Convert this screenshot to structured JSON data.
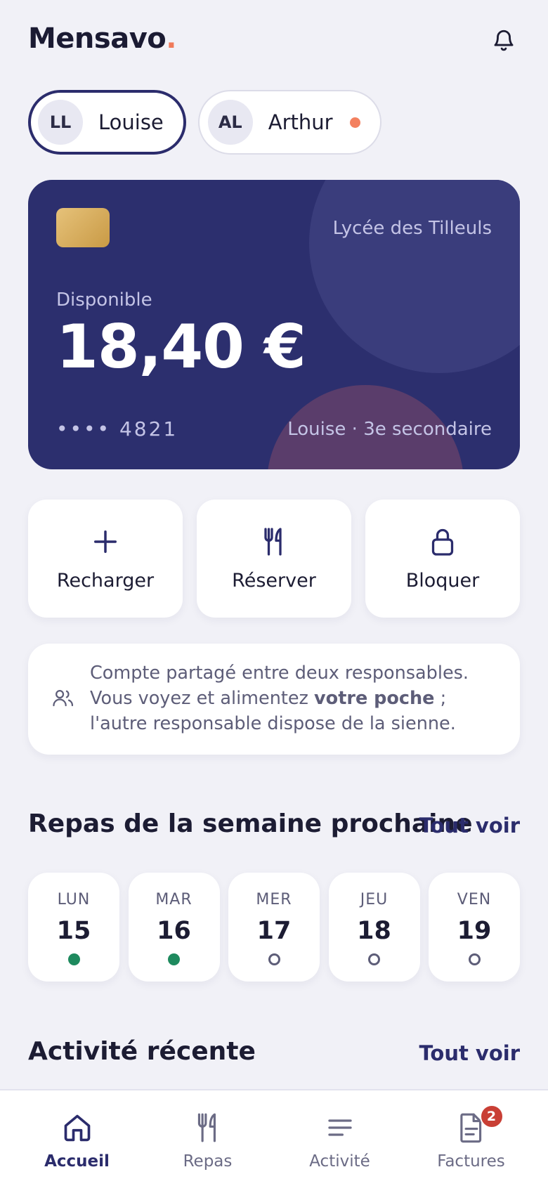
{
  "header": {
    "logo": "Mensavo",
    "logo_dot": ".",
    "icon": "bell-icon"
  },
  "children": [
    {
      "initials": "LL",
      "name": "Louise",
      "active": true,
      "has_alert": false
    },
    {
      "initials": "AL",
      "name": "Arthur",
      "active": false,
      "has_alert": true
    }
  ],
  "card": {
    "school": "Lycée des Tilleuls",
    "available_label": "Disponible",
    "balance": "18,40 €",
    "number_mask": "•••• 4821",
    "holder": "Louise · 3e secondaire"
  },
  "actions": [
    {
      "label": "Recharger",
      "icon": "plus-icon"
    },
    {
      "label": "Réserver",
      "icon": "fork-knife-icon"
    },
    {
      "label": "Bloquer",
      "icon": "lock-icon"
    }
  ],
  "info": {
    "text_before": "Compte partagé entre deux responsables. Vous voyez et alimentez ",
    "text_bold": "votre poche",
    "text_after": " ; l'autre responsable dispose de la sienne.",
    "icon": "users-icon"
  },
  "meals": {
    "title": "Repas de la semaine prochaine",
    "see_all": "Tout voir",
    "days": [
      {
        "name": "LUN",
        "num": "15",
        "booked": true
      },
      {
        "name": "MAR",
        "num": "16",
        "booked": true
      },
      {
        "name": "MER",
        "num": "17",
        "booked": false
      },
      {
        "name": "JEU",
        "num": "18",
        "booked": false
      },
      {
        "name": "VEN",
        "num": "19",
        "booked": false
      }
    ]
  },
  "activity": {
    "title": "Activité récente",
    "see_all": "Tout voir"
  },
  "nav": [
    {
      "label": "Accueil",
      "icon": "home-icon",
      "active": true
    },
    {
      "label": "Repas",
      "icon": "fork-knife-icon",
      "active": false
    },
    {
      "label": "Activité",
      "icon": "list-icon",
      "active": false
    },
    {
      "label": "Factures",
      "icon": "invoice-icon",
      "active": false,
      "badge": "2"
    }
  ],
  "colors": {
    "background": "#f1f1f7",
    "card": "#2c2f6e",
    "accent": "#2b2c6c",
    "logo_dot": "#f07a5a",
    "booked": "#1e8a5e",
    "badge": "#c93f35"
  }
}
